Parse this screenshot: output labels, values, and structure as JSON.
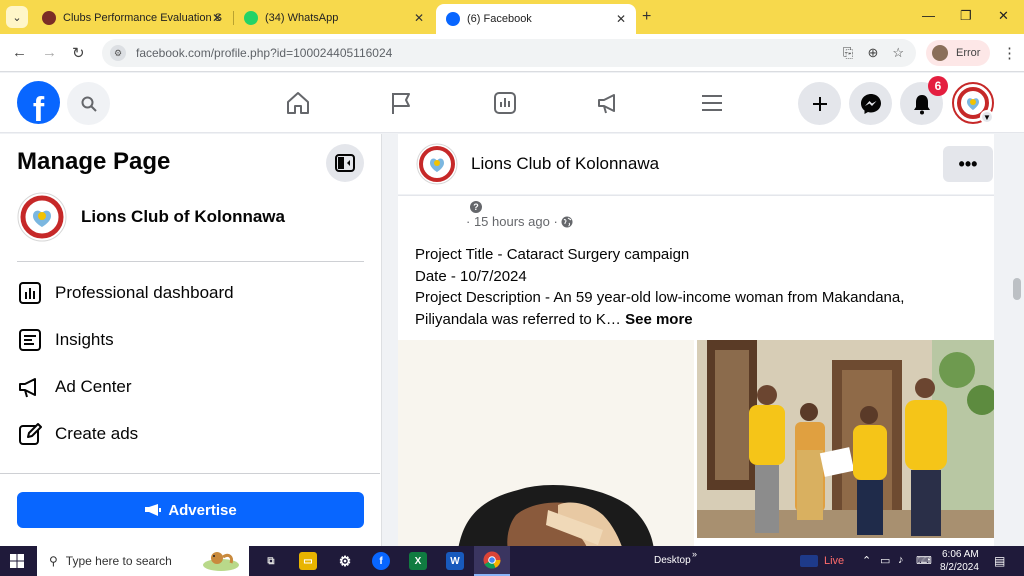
{
  "browser": {
    "tabs": [
      {
        "label": "Clubs Performance Evaluation S",
        "active": false
      },
      {
        "label": "(34) WhatsApp",
        "active": false
      },
      {
        "label": "(6) Facebook",
        "active": true
      }
    ],
    "url": "facebook.com/profile.php?id=100024405116024",
    "profile_label": "Error"
  },
  "fb": {
    "notification_count": "6",
    "brand_color": "#0866ff"
  },
  "sidebar": {
    "title": "Manage Page",
    "page_name": "Lions Club of Kolonnawa",
    "items": [
      {
        "label": "Professional dashboard",
        "icon": "dashboard-icon"
      },
      {
        "label": "Insights",
        "icon": "insights-icon"
      },
      {
        "label": "Ad Center",
        "icon": "megaphone-icon"
      },
      {
        "label": "Create ads",
        "icon": "pencil-icon"
      }
    ],
    "advertise_label": "Advertise"
  },
  "main": {
    "page_name": "Lions Club of Kolonnawa",
    "more_label": "•••",
    "post": {
      "time": "15 hours ago",
      "lines": [
        "Project Title - Cataract Surgery campaign",
        "Date - 10/7/2024",
        "Project Description - An 59 year-old low-income woman from Makandana,",
        "Piliyandala was referred to K…"
      ],
      "see_more": "See more"
    }
  },
  "taskbar": {
    "search_placeholder": "Type here to search",
    "desktop_label": "Desktop",
    "live_label": "Live",
    "time": "6:06 AM",
    "date": "8/2/2024"
  }
}
